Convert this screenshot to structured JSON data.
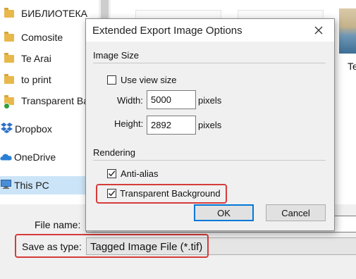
{
  "explorer": {
    "nav_items": [
      {
        "label": "БИБЛИОТЕКА",
        "icon": "folder-icon"
      },
      {
        "label": "Comosite",
        "icon": "folder-icon"
      },
      {
        "label": "Te Arai",
        "icon": "folder-icon"
      },
      {
        "label": "to print",
        "icon": "folder-icon"
      },
      {
        "label": "Transparent Background",
        "icon": "folder-icon"
      },
      {
        "label": "Dropbox",
        "icon": "dropbox-icon"
      },
      {
        "label": "OneDrive",
        "icon": "onedrive-icon"
      },
      {
        "label": "This PC",
        "icon": "this-pc-icon"
      }
    ],
    "content_thumb_label": "Te"
  },
  "save_panel": {
    "filename_label": "File name:",
    "filename_value": "",
    "savetype_label": "Save as type:",
    "savetype_value": "Tagged Image File (*.tif)"
  },
  "dialog": {
    "title": "Extended Export Image Options",
    "image_size": {
      "group_title": "Image Size",
      "use_view_size_label": "Use view size",
      "use_view_size_checked": false,
      "width_label": "Width:",
      "width_value": "5000",
      "width_unit": "pixels",
      "height_label": "Height:",
      "height_value": "2892",
      "height_unit": "pixels"
    },
    "rendering": {
      "group_title": "Rendering",
      "anti_alias_label": "Anti-alias",
      "anti_alias_checked": true,
      "transparent_label": "Transparent Background",
      "transparent_checked": true
    },
    "ok_label": "OK",
    "cancel_label": "Cancel"
  },
  "colors": {
    "highlight": "#d63b3b",
    "selection": "#cce4f7",
    "default_button_border": "#0078d7"
  }
}
